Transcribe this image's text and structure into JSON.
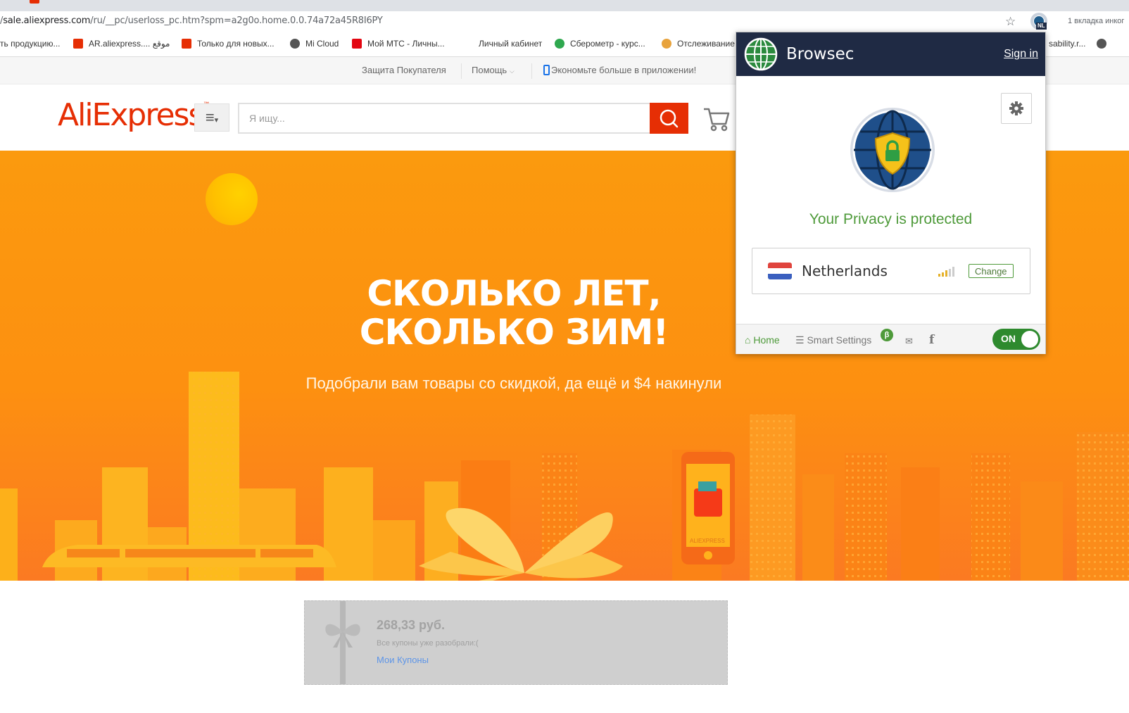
{
  "browser": {
    "url_prefix": "/",
    "url_host": "sale.aliexpress.com",
    "url_path": "/ru/__pc/userloss_pc.htm?spm=a2g0o.home.0.0.74a72a45R8I6PY",
    "ext_badge": "NL",
    "tab_count": "1 вкладка инког",
    "bookmarks": [
      {
        "label": "ть продукцию...",
        "color": "#ffffff"
      },
      {
        "label": "AR.aliexpress.... موقع",
        "color": "#e62e04"
      },
      {
        "label": "Только для новых...",
        "color": "#e62e04"
      },
      {
        "label": "Mi Cloud",
        "color": "#555555"
      },
      {
        "label": "Мой МТС - Личны...",
        "color": "#e30611"
      },
      {
        "label": "Личный кабинет",
        "color": "#ffffff"
      },
      {
        "label": "Сберометр - курс...",
        "color": "#2fa84f"
      },
      {
        "label": "Отслеживание",
        "color": "#e8a33d"
      },
      {
        "label": "sability.r...",
        "color": "#ffffff"
      }
    ]
  },
  "ali": {
    "nav": {
      "protection": "Защита Покупателя",
      "help": "Помощь",
      "app": "Экономьте больше в приложении!"
    },
    "logo": "AliExpress",
    "logo_tm": "™",
    "search_placeholder": "Я ищу...",
    "hero_title": "СКОЛЬКО ЛЕТ, СКОЛЬКО ЗИМ!",
    "hero_sub": "Подобрали вам товары со скидкой, да ещё и $4 накинули",
    "phone_label": "ALIEXPRESS",
    "coupon": {
      "amount": "268,33 руб.",
      "note": "Все купоны уже разобрали:(",
      "link": "Мои Купоны"
    }
  },
  "browsec": {
    "brand": "Browsec",
    "sign_in": "Sign in",
    "status": "Your Privacy is protected",
    "country": "Netherlands",
    "change": "Change",
    "home": "Home",
    "smart_settings": "Smart Settings",
    "beta": "β",
    "toggle": "ON",
    "colors": {
      "header": "#1f2a44",
      "accent": "#4e9a3a"
    }
  }
}
